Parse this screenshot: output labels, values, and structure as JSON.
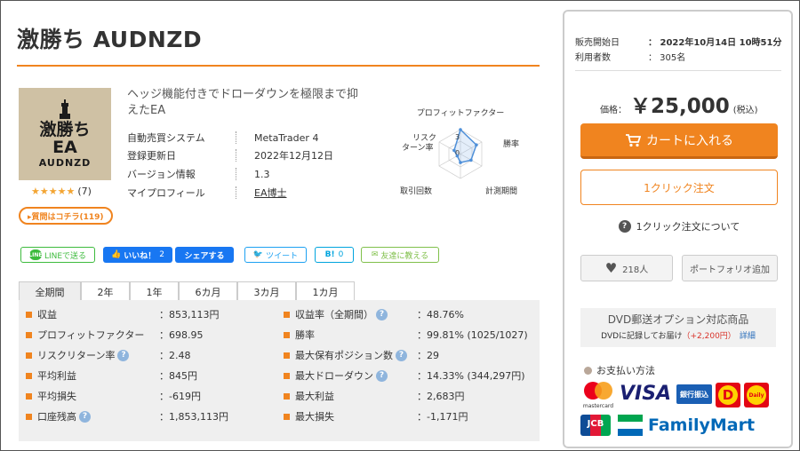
{
  "title": "激勝ち AUDNZD",
  "product_image": {
    "line1": "激勝ち",
    "line2": "EA",
    "line3": "AUDNZD"
  },
  "rating": {
    "stars": "★★★★★",
    "count": "(7)"
  },
  "qa_button": "▸質問はコチラ(119)",
  "description": "ヘッジ機能付きでドローダウンを極限まで抑えたEA",
  "info": [
    {
      "label": "自動売買システム",
      "value": "MetaTrader 4"
    },
    {
      "label": "登録更新日",
      "value": "2022年12月12日"
    },
    {
      "label": "バージョン情報",
      "value": "1.3"
    },
    {
      "label": "マイプロフィール",
      "value": "EA博士"
    }
  ],
  "radar": {
    "labels": {
      "top": "プロフィットファクター",
      "right": "勝率",
      "bottom_right": "計測期間",
      "bottom_left": "取引回数",
      "left_line1": "リスク",
      "left_line2": "ターン率"
    },
    "scale_labels": [
      "3",
      "0"
    ],
    "values": [
      1.0,
      0.75,
      0.5,
      0.35,
      0.15,
      0.3
    ]
  },
  "social": {
    "line": "LINEで送る",
    "line_badge": "LINE",
    "like": "いいね！",
    "like_count": "2",
    "share": "シェアする",
    "tweet": "ツイート",
    "hatena": "B!",
    "hatena_count": "0",
    "mail": "友達に教える"
  },
  "tabs": [
    "全期間",
    "2年",
    "1年",
    "6カ月",
    "3カ月",
    "1カ月"
  ],
  "stats_left": [
    {
      "label": "収益",
      "value": "：853,113円",
      "help": false
    },
    {
      "label": "プロフィットファクター",
      "value": "：698.95",
      "help": false
    },
    {
      "label": "リスクリターン率",
      "value": "：2.48",
      "help": true
    },
    {
      "label": "平均利益",
      "value": "：845円",
      "help": false
    },
    {
      "label": "平均損失",
      "value": "：-619円",
      "help": false
    },
    {
      "label": "口座残高",
      "value": "：1,853,113円",
      "help": true
    }
  ],
  "stats_right": [
    {
      "label": "収益率（全期間）",
      "value": "：48.76%",
      "help": true
    },
    {
      "label": "勝率",
      "value": "：99.81% (1025/1027)",
      "help": false
    },
    {
      "label": "最大保有ポジション数",
      "value": "：29",
      "help": true
    },
    {
      "label": "最大ドローダウン",
      "value": "：14.33% (344,297円)",
      "help": true
    },
    {
      "label": "最大利益",
      "value": "：2,683円",
      "help": false
    },
    {
      "label": "最大損失",
      "value": "：-1,171円",
      "help": false
    }
  ],
  "side": {
    "sale_start_label": "販売開始日",
    "sale_start_value": "：  2022年10月14日 10時51分",
    "users_label": "利用者数",
    "users_value": "：  305名",
    "price_label": "価格：",
    "price": "￥25,000",
    "tax": "(税込)",
    "cart": "カートに入れる",
    "oneclick": "1クリック注文",
    "oneclick_info": "1クリック注文について",
    "fav_count": "218人",
    "portfolio": "ポートフォリオ追加",
    "dvd_title": "DVD郵送オプション対応商品",
    "dvd_text": "DVDに記録してお届け",
    "dvd_price": "（+2,200円）",
    "dvd_link": "詳細",
    "pay_title": "お支払い方法",
    "pay": {
      "mastercard": "mastercard",
      "visa": "VISA",
      "bank": "銀行振込",
      "daily_d": "D",
      "daily": "Daily",
      "jcb": "JCB",
      "famima": "FamilyMart"
    }
  },
  "colors": {
    "accent": "#f0841f",
    "visa": "#1a1f71",
    "famima_green": "#00a54f",
    "famima_blue": "#0068b7"
  }
}
